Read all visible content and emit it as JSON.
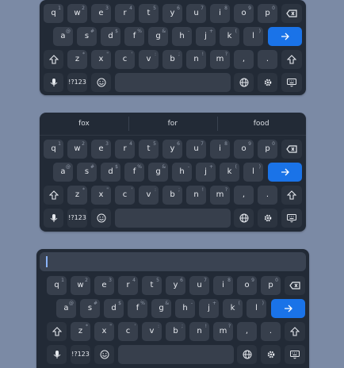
{
  "colors": {
    "page_bg": "#7b8aa5",
    "keyboard_bg": "#222a36",
    "key_bg": "#373f4c",
    "mod_bg": "#2c3440",
    "enter_bg": "#1a73e8",
    "caret": "#8ab4f8"
  },
  "keyboards": [
    {
      "name": "keyboard-basic",
      "row1": [
        {
          "l": "q",
          "h": "1"
        },
        {
          "l": "w",
          "h": "2"
        },
        {
          "l": "e",
          "h": "3"
        },
        {
          "l": "r",
          "h": "4"
        },
        {
          "l": "t",
          "h": "5"
        },
        {
          "l": "y",
          "h": "6"
        },
        {
          "l": "u",
          "h": "7"
        },
        {
          "l": "i",
          "h": "8"
        },
        {
          "l": "o",
          "h": "9"
        },
        {
          "l": "p",
          "h": "0"
        }
      ],
      "row2": [
        {
          "l": "a",
          "h": "@"
        },
        {
          "l": "s",
          "h": "#"
        },
        {
          "l": "d",
          "h": "$"
        },
        {
          "l": "f",
          "h": "%"
        },
        {
          "l": "g",
          "h": "&"
        },
        {
          "l": "h",
          "h": "-"
        },
        {
          "l": "j",
          "h": "+"
        },
        {
          "l": "k",
          "h": "("
        },
        {
          "l": "l",
          "h": ")"
        }
      ],
      "row3": [
        {
          "l": "z",
          "h": "*"
        },
        {
          "l": "x",
          "h": "\""
        },
        {
          "l": "c",
          "h": "'"
        },
        {
          "l": "v",
          "h": ":"
        },
        {
          "l": "b",
          "h": ";"
        },
        {
          "l": "n",
          "h": "!"
        },
        {
          "l": "m",
          "h": "?"
        },
        {
          "l": ",",
          "h": ""
        },
        {
          "l": ".",
          "h": ""
        }
      ],
      "symbols_label": "!?123"
    },
    {
      "name": "keyboard-suggestions",
      "suggestions": [
        "fox",
        "for",
        "food"
      ],
      "row1": [
        {
          "l": "q",
          "h": "1"
        },
        {
          "l": "w",
          "h": "2"
        },
        {
          "l": "e",
          "h": "3"
        },
        {
          "l": "r",
          "h": "4"
        },
        {
          "l": "t",
          "h": "5"
        },
        {
          "l": "y",
          "h": "6"
        },
        {
          "l": "u",
          "h": "7"
        },
        {
          "l": "i",
          "h": "8"
        },
        {
          "l": "o",
          "h": "9"
        },
        {
          "l": "p",
          "h": "0"
        }
      ],
      "row2": [
        {
          "l": "a",
          "h": "@"
        },
        {
          "l": "s",
          "h": "#"
        },
        {
          "l": "d",
          "h": "$"
        },
        {
          "l": "f",
          "h": "%"
        },
        {
          "l": "g",
          "h": "&"
        },
        {
          "l": "h",
          "h": "-"
        },
        {
          "l": "j",
          "h": "+"
        },
        {
          "l": "k",
          "h": "("
        },
        {
          "l": "l",
          "h": ")"
        }
      ],
      "row3": [
        {
          "l": "z",
          "h": "*"
        },
        {
          "l": "x",
          "h": "\""
        },
        {
          "l": "c",
          "h": "'"
        },
        {
          "l": "v",
          "h": ":"
        },
        {
          "l": "b",
          "h": ";"
        },
        {
          "l": "n",
          "h": "!"
        },
        {
          "l": "m",
          "h": "?"
        },
        {
          "l": ",",
          "h": ""
        },
        {
          "l": ".",
          "h": ""
        }
      ],
      "symbols_label": "!?123"
    },
    {
      "name": "keyboard-input",
      "input_value": "",
      "row1": [
        {
          "l": "q",
          "h": "1"
        },
        {
          "l": "w",
          "h": "2"
        },
        {
          "l": "e",
          "h": "3"
        },
        {
          "l": "r",
          "h": "4"
        },
        {
          "l": "t",
          "h": "5"
        },
        {
          "l": "y",
          "h": "6"
        },
        {
          "l": "u",
          "h": "7"
        },
        {
          "l": "i",
          "h": "8"
        },
        {
          "l": "o",
          "h": "9"
        },
        {
          "l": "p",
          "h": "0"
        }
      ],
      "row2": [
        {
          "l": "a",
          "h": "@"
        },
        {
          "l": "s",
          "h": "#"
        },
        {
          "l": "d",
          "h": "$"
        },
        {
          "l": "f",
          "h": "%"
        },
        {
          "l": "g",
          "h": "&"
        },
        {
          "l": "h",
          "h": "-"
        },
        {
          "l": "j",
          "h": "+"
        },
        {
          "l": "k",
          "h": "("
        },
        {
          "l": "l",
          "h": ")"
        }
      ],
      "row3": [
        {
          "l": "z",
          "h": "*"
        },
        {
          "l": "x",
          "h": "\""
        },
        {
          "l": "c",
          "h": "'"
        },
        {
          "l": "v",
          "h": ":"
        },
        {
          "l": "b",
          "h": ";"
        },
        {
          "l": "n",
          "h": "!"
        },
        {
          "l": "m",
          "h": "?"
        },
        {
          "l": ",",
          "h": ""
        },
        {
          "l": ".",
          "h": ""
        }
      ],
      "symbols_label": "!?123"
    }
  ],
  "icons": {
    "backspace": "backspace-icon",
    "enter": "arrow-right-icon",
    "shift": "shift-icon",
    "mic": "mic-icon",
    "emoji": "emoji-icon",
    "globe": "globe-icon",
    "settings": "gear-icon",
    "hide": "keyboard-hide-icon"
  }
}
